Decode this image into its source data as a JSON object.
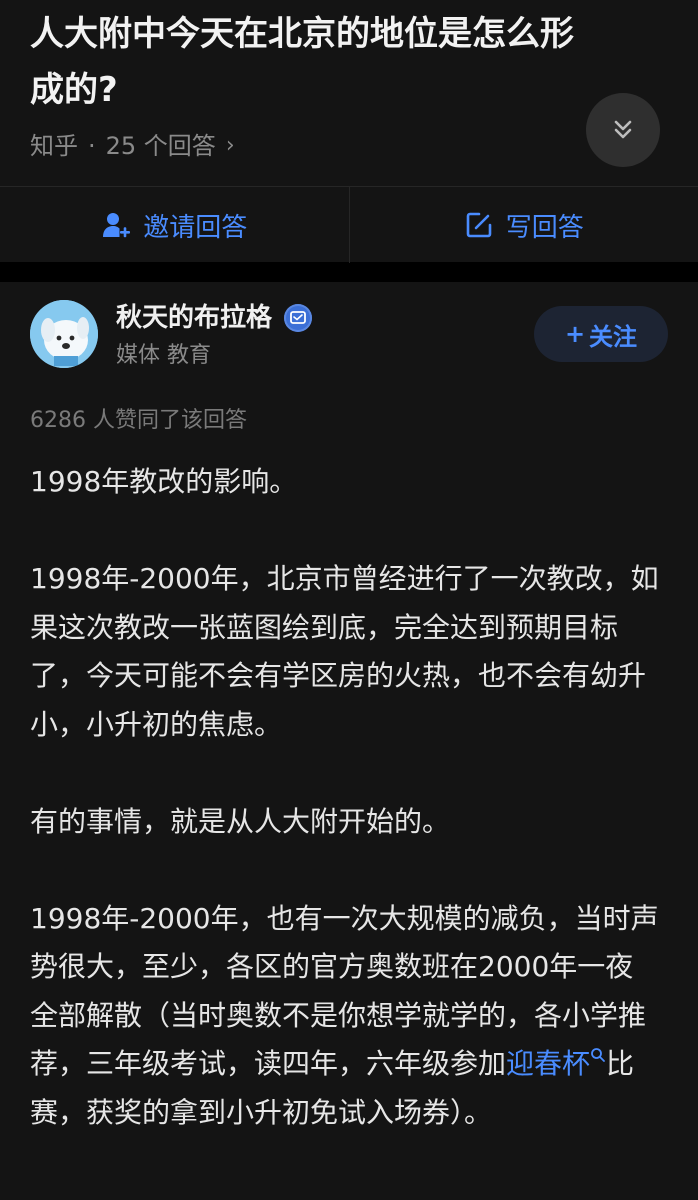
{
  "question": {
    "title": "人大附中今天在北京的地位是怎么形成的?",
    "source": "知乎",
    "separator": "·",
    "answer_count_text": "25 个回答",
    "chevron": "›"
  },
  "actions": {
    "invite_label": "邀请回答",
    "write_label": "写回答"
  },
  "author": {
    "name": "秋天的布拉格",
    "tags": "媒体 教育",
    "follow_label": "关注",
    "follow_prefix": "+"
  },
  "answer": {
    "vote_summary": "6286 人赞同了该回答",
    "paragraphs": {
      "p1": "1998年教改的影响。",
      "p2": "1998年-2000年，北京市曾经进行了一次教改，如果这次教改一张蓝图绘到底，完全达到预期目标了，今天可能不会有学区房的火热，也不会有幼升小，小升初的焦虑。",
      "p3": "有的事情，就是从人大附开始的。",
      "p4_before": "1998年-2000年，也有一次大规模的减负，当时声势很大，至少，各区的官方奥数班在2000年一夜全部解散（当时奥数不是你想学就学的，各小学推荐，三年级考试，读四年，六年级参加",
      "p4_link": "迎春杯",
      "p4_after": "比赛，获奖的拿到小升初免试入场券）。"
    }
  },
  "icons": {
    "collapse": "double-chevron-down-icon",
    "invite": "add-user-icon",
    "write": "edit-icon",
    "verified": "verified-badge-icon",
    "search_link": "search-icon"
  },
  "colors": {
    "background": "#000000",
    "card": "#141414",
    "accent": "#4a8cff",
    "muted_text": "#8a8a8a",
    "body_text": "#e6e6e6"
  }
}
